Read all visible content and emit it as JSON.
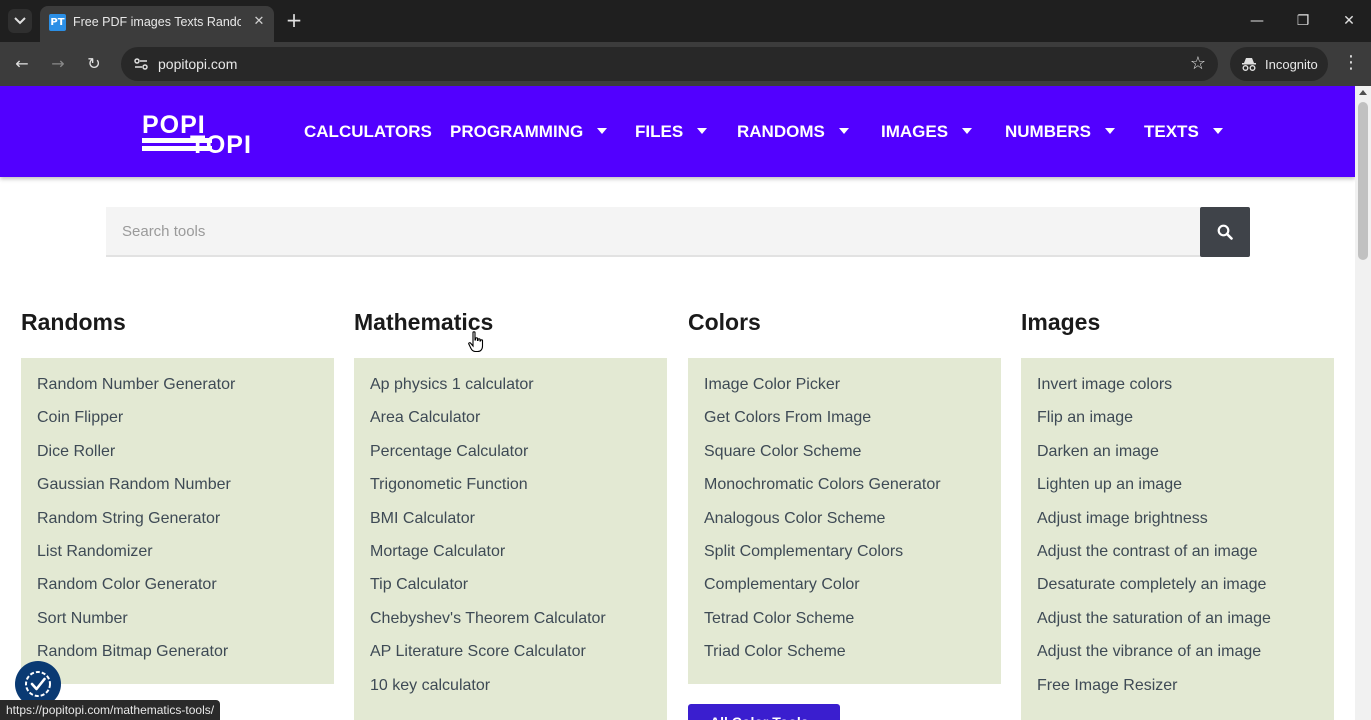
{
  "browser": {
    "tab_title": "Free PDF images Texts Random",
    "favicon_text": "PT",
    "url": "popitopi.com",
    "incognito_label": "Incognito",
    "status_url": "https://popitopi.com/mathematics-tools/"
  },
  "site": {
    "logo_top": "POPI",
    "logo_bottom": "TOPI",
    "brand_color": "#5200ff",
    "menu": [
      {
        "label": "CALCULATORS",
        "has_dropdown": false
      },
      {
        "label": "PROGRAMMING",
        "has_dropdown": true
      },
      {
        "label": "FILES",
        "has_dropdown": true
      },
      {
        "label": "RANDOMS",
        "has_dropdown": true
      },
      {
        "label": "IMAGES",
        "has_dropdown": true
      },
      {
        "label": "NUMBERS",
        "has_dropdown": true
      },
      {
        "label": "TEXTS",
        "has_dropdown": true
      }
    ]
  },
  "search": {
    "placeholder": "Search tools",
    "value": ""
  },
  "columns": [
    {
      "title": "Randoms",
      "links": [
        "Random Number Generator",
        "Coin Flipper",
        "Dice Roller",
        "Gaussian Random Number",
        "Random String Generator",
        "List Randomizer",
        "Random Color Generator",
        "Sort Number",
        "Random Bitmap Generator"
      ]
    },
    {
      "title": "Mathematics",
      "links": [
        "Ap physics 1 calculator",
        "Area Calculator",
        "Percentage Calculator",
        "Trigonometic Function",
        "BMI Calculator",
        "Mortage Calculator",
        "Tip Calculator",
        "Chebyshev's Theorem Calculator",
        "AP Literature Score Calculator",
        "10 key calculator"
      ]
    },
    {
      "title": "Colors",
      "links": [
        "Image Color Picker",
        "Get Colors From Image",
        "Square Color Scheme",
        "Monochromatic Colors Generator",
        "Analogous Color Scheme",
        "Split Complementary Colors",
        "Complementary Color",
        "Tetrad Color Scheme",
        "Triad Color Scheme"
      ]
    },
    {
      "title": "Images",
      "links": [
        "Invert image colors",
        "Flip an image",
        "Darken an image",
        "Lighten up an image",
        "Adjust image brightness",
        "Adjust the contrast of an image",
        "Desaturate completely an image",
        "Adjust the saturation of an image",
        "Adjust the vibrance of an image",
        "Free Image Resizer"
      ]
    }
  ],
  "all_colors_button": "All Color Tools",
  "icons": {
    "search": "search-icon",
    "cookie": "accessibility-check-icon",
    "incognito": "incognito-icon"
  }
}
